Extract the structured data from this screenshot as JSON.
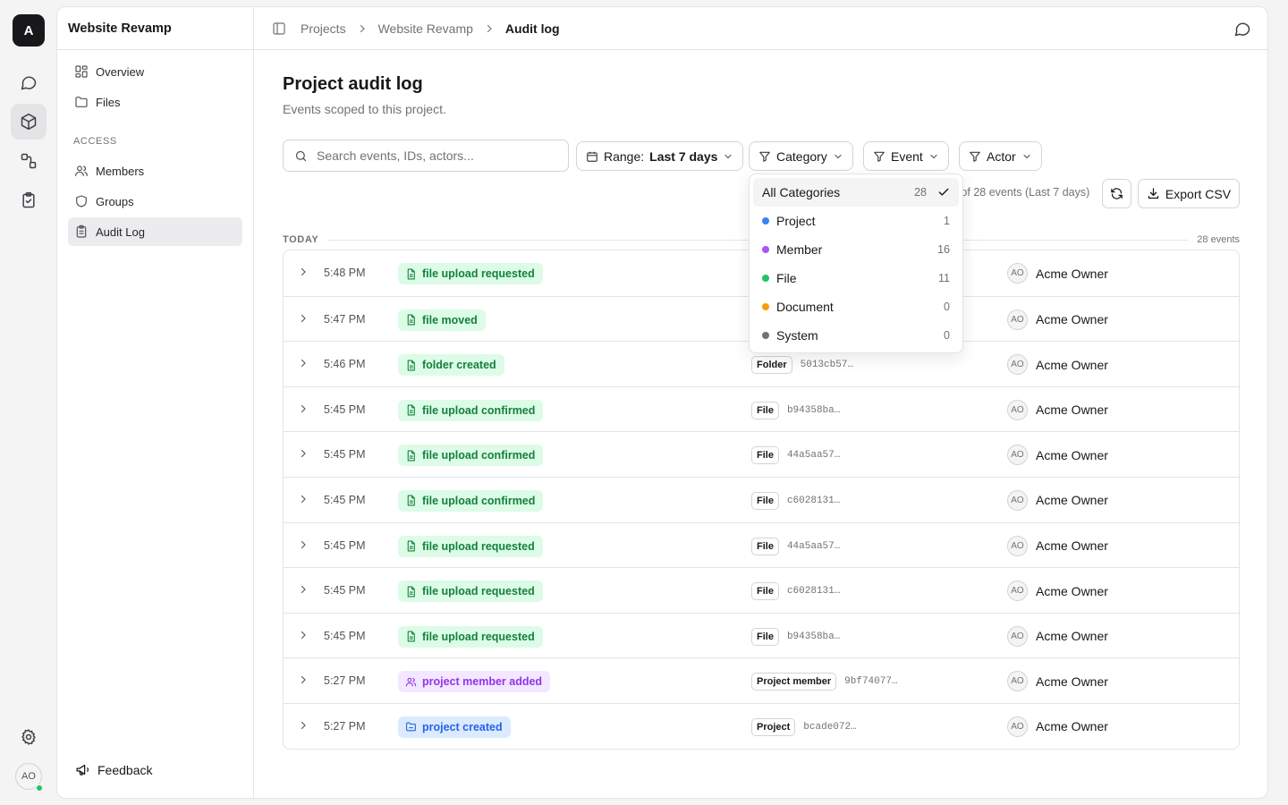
{
  "rail": {
    "logo": "A",
    "avatar": "AO"
  },
  "sidebar": {
    "project_name": "Website Revamp",
    "items": [
      {
        "label": "Overview"
      },
      {
        "label": "Files"
      }
    ],
    "section_label": "ACCESS",
    "access_items": [
      {
        "label": "Members"
      },
      {
        "label": "Groups"
      },
      {
        "label": "Audit Log"
      }
    ],
    "feedback_label": "Feedback"
  },
  "breadcrumb": [
    "Projects",
    "Website Revamp",
    "Audit log"
  ],
  "header": {
    "title": "Project audit log",
    "subtitle": "Events scoped to this project."
  },
  "search": {
    "placeholder": "Search events, IDs, actors..."
  },
  "filters": {
    "range_label": "Range:",
    "range_value": "Last 7 days",
    "category": "Category",
    "event": "Event",
    "actor": "Actor"
  },
  "events_count_text": "8 of 28 events (Last 7 days)",
  "export_label": "Export CSV",
  "group": {
    "label": "TODAY",
    "count": "28 events"
  },
  "category_dropdown": [
    {
      "label": "All Categories",
      "count": "28",
      "selected": true
    },
    {
      "label": "Project",
      "count": "1",
      "color": "#3b82f6"
    },
    {
      "label": "Member",
      "count": "16",
      "color": "#a855f7"
    },
    {
      "label": "File",
      "count": "11",
      "color": "#22c55e"
    },
    {
      "label": "Document",
      "count": "0",
      "color": "#f59e0b"
    },
    {
      "label": "System",
      "count": "0",
      "color": "#71717a"
    }
  ],
  "rows": [
    {
      "time": "5:48 PM",
      "event": "file upload requested",
      "kind": "file",
      "target_type": "",
      "target_id": "",
      "actor_initials": "AO",
      "actor": "Acme Owner"
    },
    {
      "time": "5:47 PM",
      "event": "file moved",
      "kind": "file",
      "target_type": "",
      "target_id": "",
      "actor_initials": "AO",
      "actor": "Acme Owner"
    },
    {
      "time": "5:46 PM",
      "event": "folder created",
      "kind": "file",
      "target_type": "Folder",
      "target_id": "5013cb57…",
      "actor_initials": "AO",
      "actor": "Acme Owner"
    },
    {
      "time": "5:45 PM",
      "event": "file upload confirmed",
      "kind": "file",
      "target_type": "File",
      "target_id": "b94358ba…",
      "actor_initials": "AO",
      "actor": "Acme Owner"
    },
    {
      "time": "5:45 PM",
      "event": "file upload confirmed",
      "kind": "file",
      "target_type": "File",
      "target_id": "44a5aa57…",
      "actor_initials": "AO",
      "actor": "Acme Owner"
    },
    {
      "time": "5:45 PM",
      "event": "file upload confirmed",
      "kind": "file",
      "target_type": "File",
      "target_id": "c6028131…",
      "actor_initials": "AO",
      "actor": "Acme Owner"
    },
    {
      "time": "5:45 PM",
      "event": "file upload requested",
      "kind": "file",
      "target_type": "File",
      "target_id": "44a5aa57…",
      "actor_initials": "AO",
      "actor": "Acme Owner"
    },
    {
      "time": "5:45 PM",
      "event": "file upload requested",
      "kind": "file",
      "target_type": "File",
      "target_id": "c6028131…",
      "actor_initials": "AO",
      "actor": "Acme Owner"
    },
    {
      "time": "5:45 PM",
      "event": "file upload requested",
      "kind": "file",
      "target_type": "File",
      "target_id": "b94358ba…",
      "actor_initials": "AO",
      "actor": "Acme Owner"
    },
    {
      "time": "5:27 PM",
      "event": "project member added",
      "kind": "member",
      "target_type": "Project member",
      "target_id": "9bf74077…",
      "actor_initials": "AO",
      "actor": "Acme Owner"
    },
    {
      "time": "5:27 PM",
      "event": "project created",
      "kind": "project",
      "target_type": "Project",
      "target_id": "bcade072…",
      "actor_initials": "AO",
      "actor": "Acme Owner"
    }
  ]
}
